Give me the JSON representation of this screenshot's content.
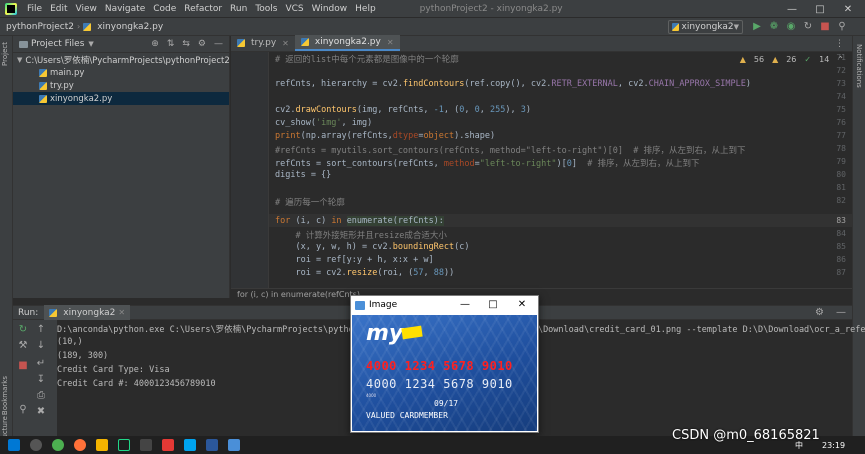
{
  "menubar": {
    "items": [
      "File",
      "Edit",
      "View",
      "Navigate",
      "Code",
      "Refactor",
      "Run",
      "Tools",
      "VCS",
      "Window",
      "Help"
    ],
    "window_title": "pythonProject2 - xinyongka2.py"
  },
  "navbar": {
    "project": "pythonProject2",
    "file": "xinyongka2.py",
    "run_config": "xinyongka2"
  },
  "project_panel": {
    "title": "Project Files",
    "root": "C:\\Users\\罗依楠\\PycharmProjects\\pythonProject2",
    "files": [
      "main.py",
      "try.py",
      "xinyongka2.py"
    ]
  },
  "editor": {
    "tabs": [
      "try.py",
      "xinyongka2.py"
    ],
    "inspections": {
      "warnings": "56",
      "weak_warnings": "26",
      "typos": "14"
    },
    "line_numbers": [
      "71",
      "72",
      "73",
      "74",
      "75",
      "76",
      "77",
      "78",
      "79",
      "80",
      "81",
      "82",
      "83",
      "84",
      "85",
      "86",
      "87"
    ],
    "breadcrumb": "for (i, c) in enumerate(refCnts)"
  },
  "side_tabs": {
    "left_top": "Project",
    "left_bottom_1": "Bookmarks",
    "left_bottom_2": "Structure",
    "right": "Notifications"
  },
  "run_panel": {
    "label": "Run:",
    "tab": "xinyongka2",
    "console": [
      "D:\\anconda\\python.exe C:\\Users\\罗依楠\\PycharmProjects\\pythonProject2/xinyongka2.py --image D:\\D\\Download\\credit_card_01.png --template D:\\D\\Download\\ocr_a_refere",
      "(10,)",
      "(189, 300)",
      "Credit Card Type: Visa",
      "Credit Card #: 4000123456789010"
    ]
  },
  "image_window": {
    "title": "Image",
    "card": {
      "brand": "my",
      "number_red": "4000 1234 5678 9010",
      "number": "4000 1234 5678 9010",
      "small_digits": "4000",
      "expiry": "09/17",
      "member": "VALUED CARDMEMBER"
    }
  },
  "taskbar": {
    "clock": "23:19",
    "ime": "中"
  },
  "watermark": "CSDN @m0_68165821"
}
